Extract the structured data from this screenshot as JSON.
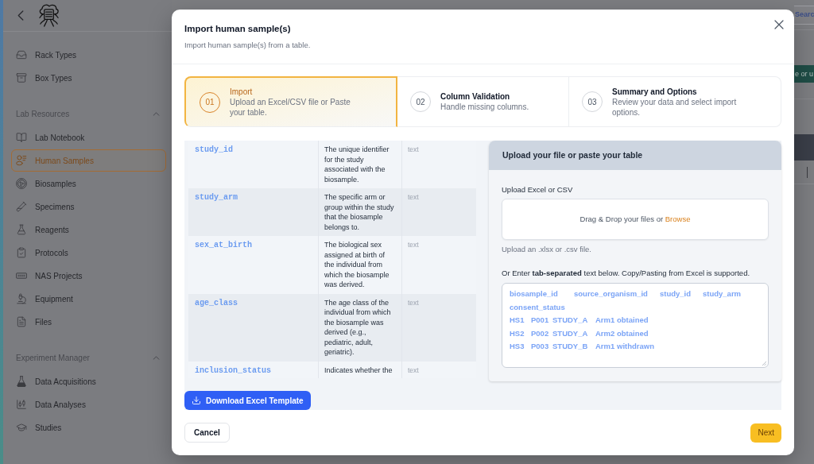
{
  "sidebar": {
    "groups": [
      {
        "items": [
          {
            "label": "Rack Types",
            "selected": false
          },
          {
            "label": "Box Types",
            "selected": false
          }
        ]
      },
      {
        "title": "Lab Resources",
        "expanded": true,
        "items": [
          {
            "label": "Lab Notebook",
            "selected": false
          },
          {
            "label": "Human Samples",
            "selected": true
          },
          {
            "label": "Biosamples",
            "selected": false
          },
          {
            "label": "Specimens",
            "selected": false
          },
          {
            "label": "Reagents",
            "selected": false
          },
          {
            "label": "Protocols",
            "selected": false
          },
          {
            "label": "NAS Projects",
            "selected": false
          },
          {
            "label": "Equipment",
            "selected": false
          },
          {
            "label": "Files",
            "selected": false
          }
        ]
      },
      {
        "title": "Experiment Manager",
        "expanded": true,
        "items": [
          {
            "label": "Data Acquisitions",
            "selected": false
          },
          {
            "label": "Data Analyses",
            "selected": false
          },
          {
            "label": "Studies",
            "selected": false
          }
        ]
      }
    ]
  },
  "background": {
    "search_button": "Searc",
    "banner_text": "e or u"
  },
  "dialog": {
    "title": "Import human sample(s)",
    "subtitle": "Import human sample(s) from a table.",
    "steps": [
      {
        "number": "01",
        "title": "Import",
        "description": "Upload an Excel/CSV file or Paste your table.",
        "selected": true
      },
      {
        "number": "02",
        "title": "Column Validation",
        "description": "Handle missing columns.",
        "selected": false
      },
      {
        "number": "03",
        "title": "Summary and Options",
        "description": "Review your data and select import options.",
        "selected": false
      }
    ],
    "fields_table": {
      "rows": [
        {
          "name": "study_id",
          "description": "The unique identifier for the study associated with the biosample.",
          "type": "text"
        },
        {
          "name": "study_arm",
          "description": "The specific arm or group within the study that the biosample belongs to.",
          "type": "text"
        },
        {
          "name": "sex_at_birth",
          "description": "The biological sex assigned at birth of the individual from which the biosample was derived.",
          "type": "text"
        },
        {
          "name": "age_class",
          "description": "The age class of the individual from which the biosample was derived (e.g., pediatric, adult, geriatric).",
          "type": "text"
        },
        {
          "name": "inclusion_status",
          "description": "Indicates whether the",
          "type": "text"
        }
      ]
    },
    "download_button": "Download Excel Template",
    "upload_panel": {
      "title": "Upload your file or paste your table",
      "upload_label": "Upload Excel or CSV",
      "dropzone_text": "Drag & Drop your files or",
      "browse_link": "Browse",
      "upload_hint": "Upload an .xlsx or .csv file.",
      "paste_label": "Or Enter **tab-separated** text below. Copy/Pasting from Excel is supported.",
      "paste_value": "biosample_id\tsource_organism_id\tstudy_id\tstudy_arm\tconsent_status\nHS1\tP001\tSTUDY_A\tArm1\tobtained\nHS2\tP002\tSTUDY_A\tArm2\tobtained\nHS3\tP003\tSTUDY_B\tArm1\twithdrawn"
    },
    "buttons": {
      "cancel": "Cancel",
      "next": "Next"
    }
  }
}
